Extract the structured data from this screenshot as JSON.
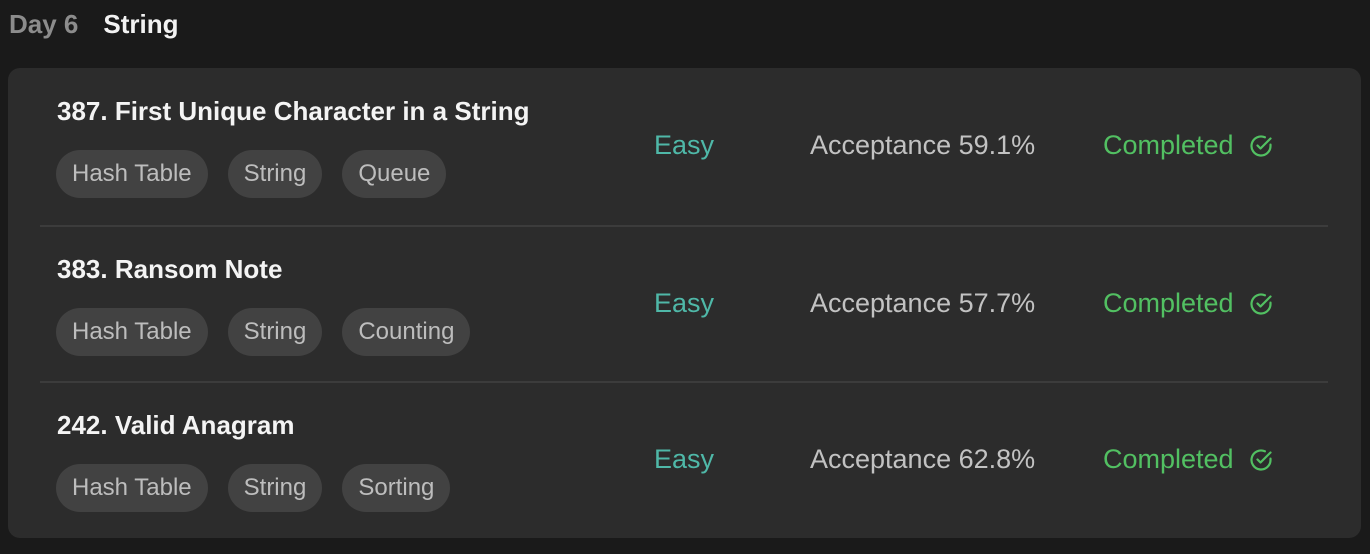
{
  "header": {
    "day": "Day 6",
    "topic": "String"
  },
  "problems": [
    {
      "title": "387. First Unique Character in a String",
      "tags": [
        "Hash Table",
        "String",
        "Queue"
      ],
      "difficulty": "Easy",
      "acceptance": "Acceptance 59.1%",
      "status": "Completed",
      "status_icon": "check-circle-icon"
    },
    {
      "title": "383. Ransom Note",
      "tags": [
        "Hash Table",
        "String",
        "Counting"
      ],
      "difficulty": "Easy",
      "acceptance": "Acceptance 57.7%",
      "status": "Completed",
      "status_icon": "check-circle-icon"
    },
    {
      "title": "242. Valid Anagram",
      "tags": [
        "Hash Table",
        "String",
        "Sorting"
      ],
      "difficulty": "Easy",
      "acceptance": "Acceptance 62.8%",
      "status": "Completed",
      "status_icon": "check-circle-icon"
    }
  ],
  "colors": {
    "background": "#1a1a1a",
    "card": "#2c2c2c",
    "easy": "#4fb8a8",
    "completed": "#52c062",
    "tag_bg": "#424242"
  }
}
